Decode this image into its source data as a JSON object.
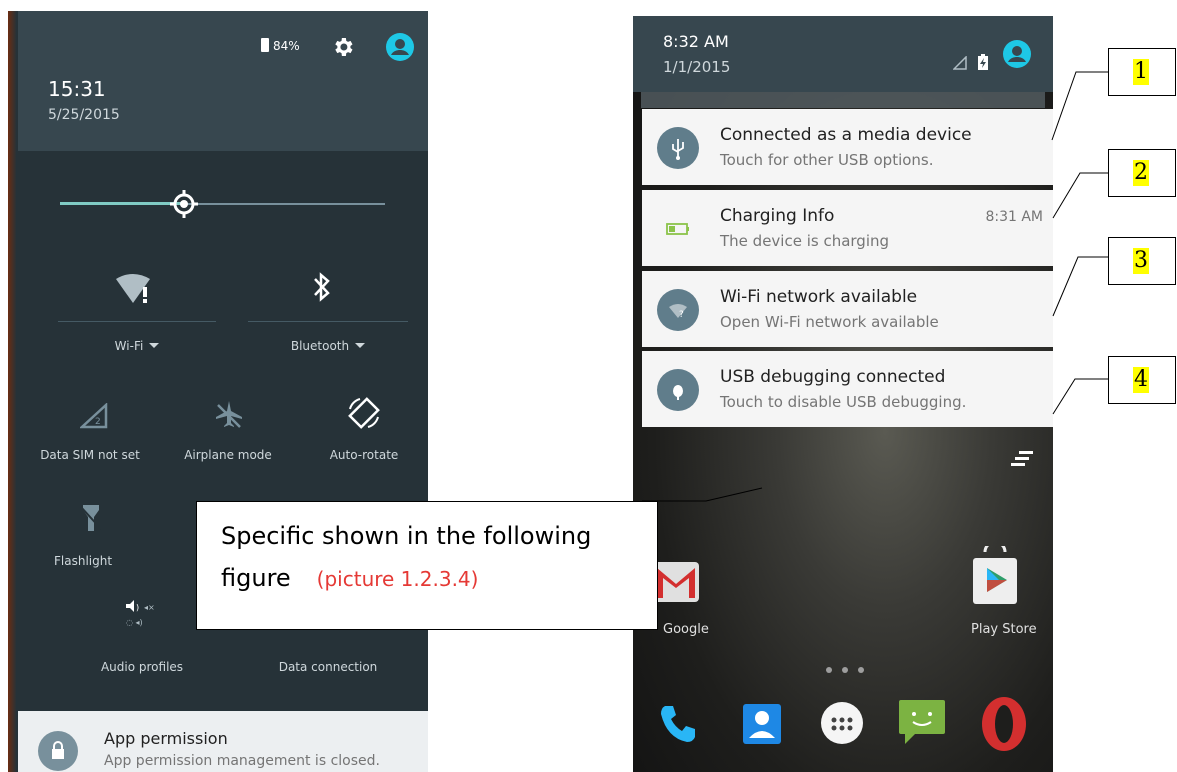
{
  "left_phone": {
    "status": {
      "battery_percent": "84%",
      "settings_icon": "gear-icon",
      "account_icon": "account-circle-icon"
    },
    "time": "15:31",
    "date": "5/25/2015",
    "brightness_level": 0.38,
    "tiles": [
      {
        "label": "Wi-Fi",
        "icon": "wifi-alert-icon"
      },
      {
        "label": "Bluetooth",
        "icon": "bluetooth-icon"
      },
      {
        "label": "Data SIM not set",
        "icon": "signal-icon"
      },
      {
        "label": "Airplane mode",
        "icon": "airplane-icon"
      },
      {
        "label": "Auto-rotate",
        "icon": "rotate-icon"
      },
      {
        "label": "Flashlight",
        "icon": "flashlight-icon"
      },
      {
        "label": "Audio profiles",
        "icon": "audio-profiles-icon"
      },
      {
        "label": "Data connection",
        "icon": "data-connection-icon"
      }
    ],
    "notification": {
      "title": "App permission",
      "subtitle": "App permission management is closed."
    }
  },
  "right_phone": {
    "time": "8:32 AM",
    "date": "1/1/2015",
    "notifications": [
      {
        "title": "Connected as a media device",
        "subtitle": "Touch for other USB options.",
        "time": "",
        "icon": "usb-icon"
      },
      {
        "title": "Charging Info",
        "subtitle": "The device is charging",
        "time": "8:31 AM",
        "icon": "battery-charging-icon"
      },
      {
        "title": "Wi-Fi network available",
        "subtitle": "Open Wi-Fi network available",
        "time": "",
        "icon": "wifi-question-icon"
      },
      {
        "title": "USB debugging connected",
        "subtitle": "Touch to disable USB debugging.",
        "time": "",
        "icon": "android-debug-icon"
      }
    ],
    "home_apps": [
      {
        "label": "Google"
      },
      {
        "label": "Play Store"
      }
    ],
    "dock": [
      "phone-icon",
      "contacts-icon",
      "app-drawer-icon",
      "messaging-icon",
      "opera-icon"
    ]
  },
  "callouts": [
    "1",
    "2",
    "3",
    "4"
  ],
  "caption": {
    "line1": "Specific shown in the following",
    "line2": "figure",
    "note": "(picture 1.2.3.4)"
  }
}
